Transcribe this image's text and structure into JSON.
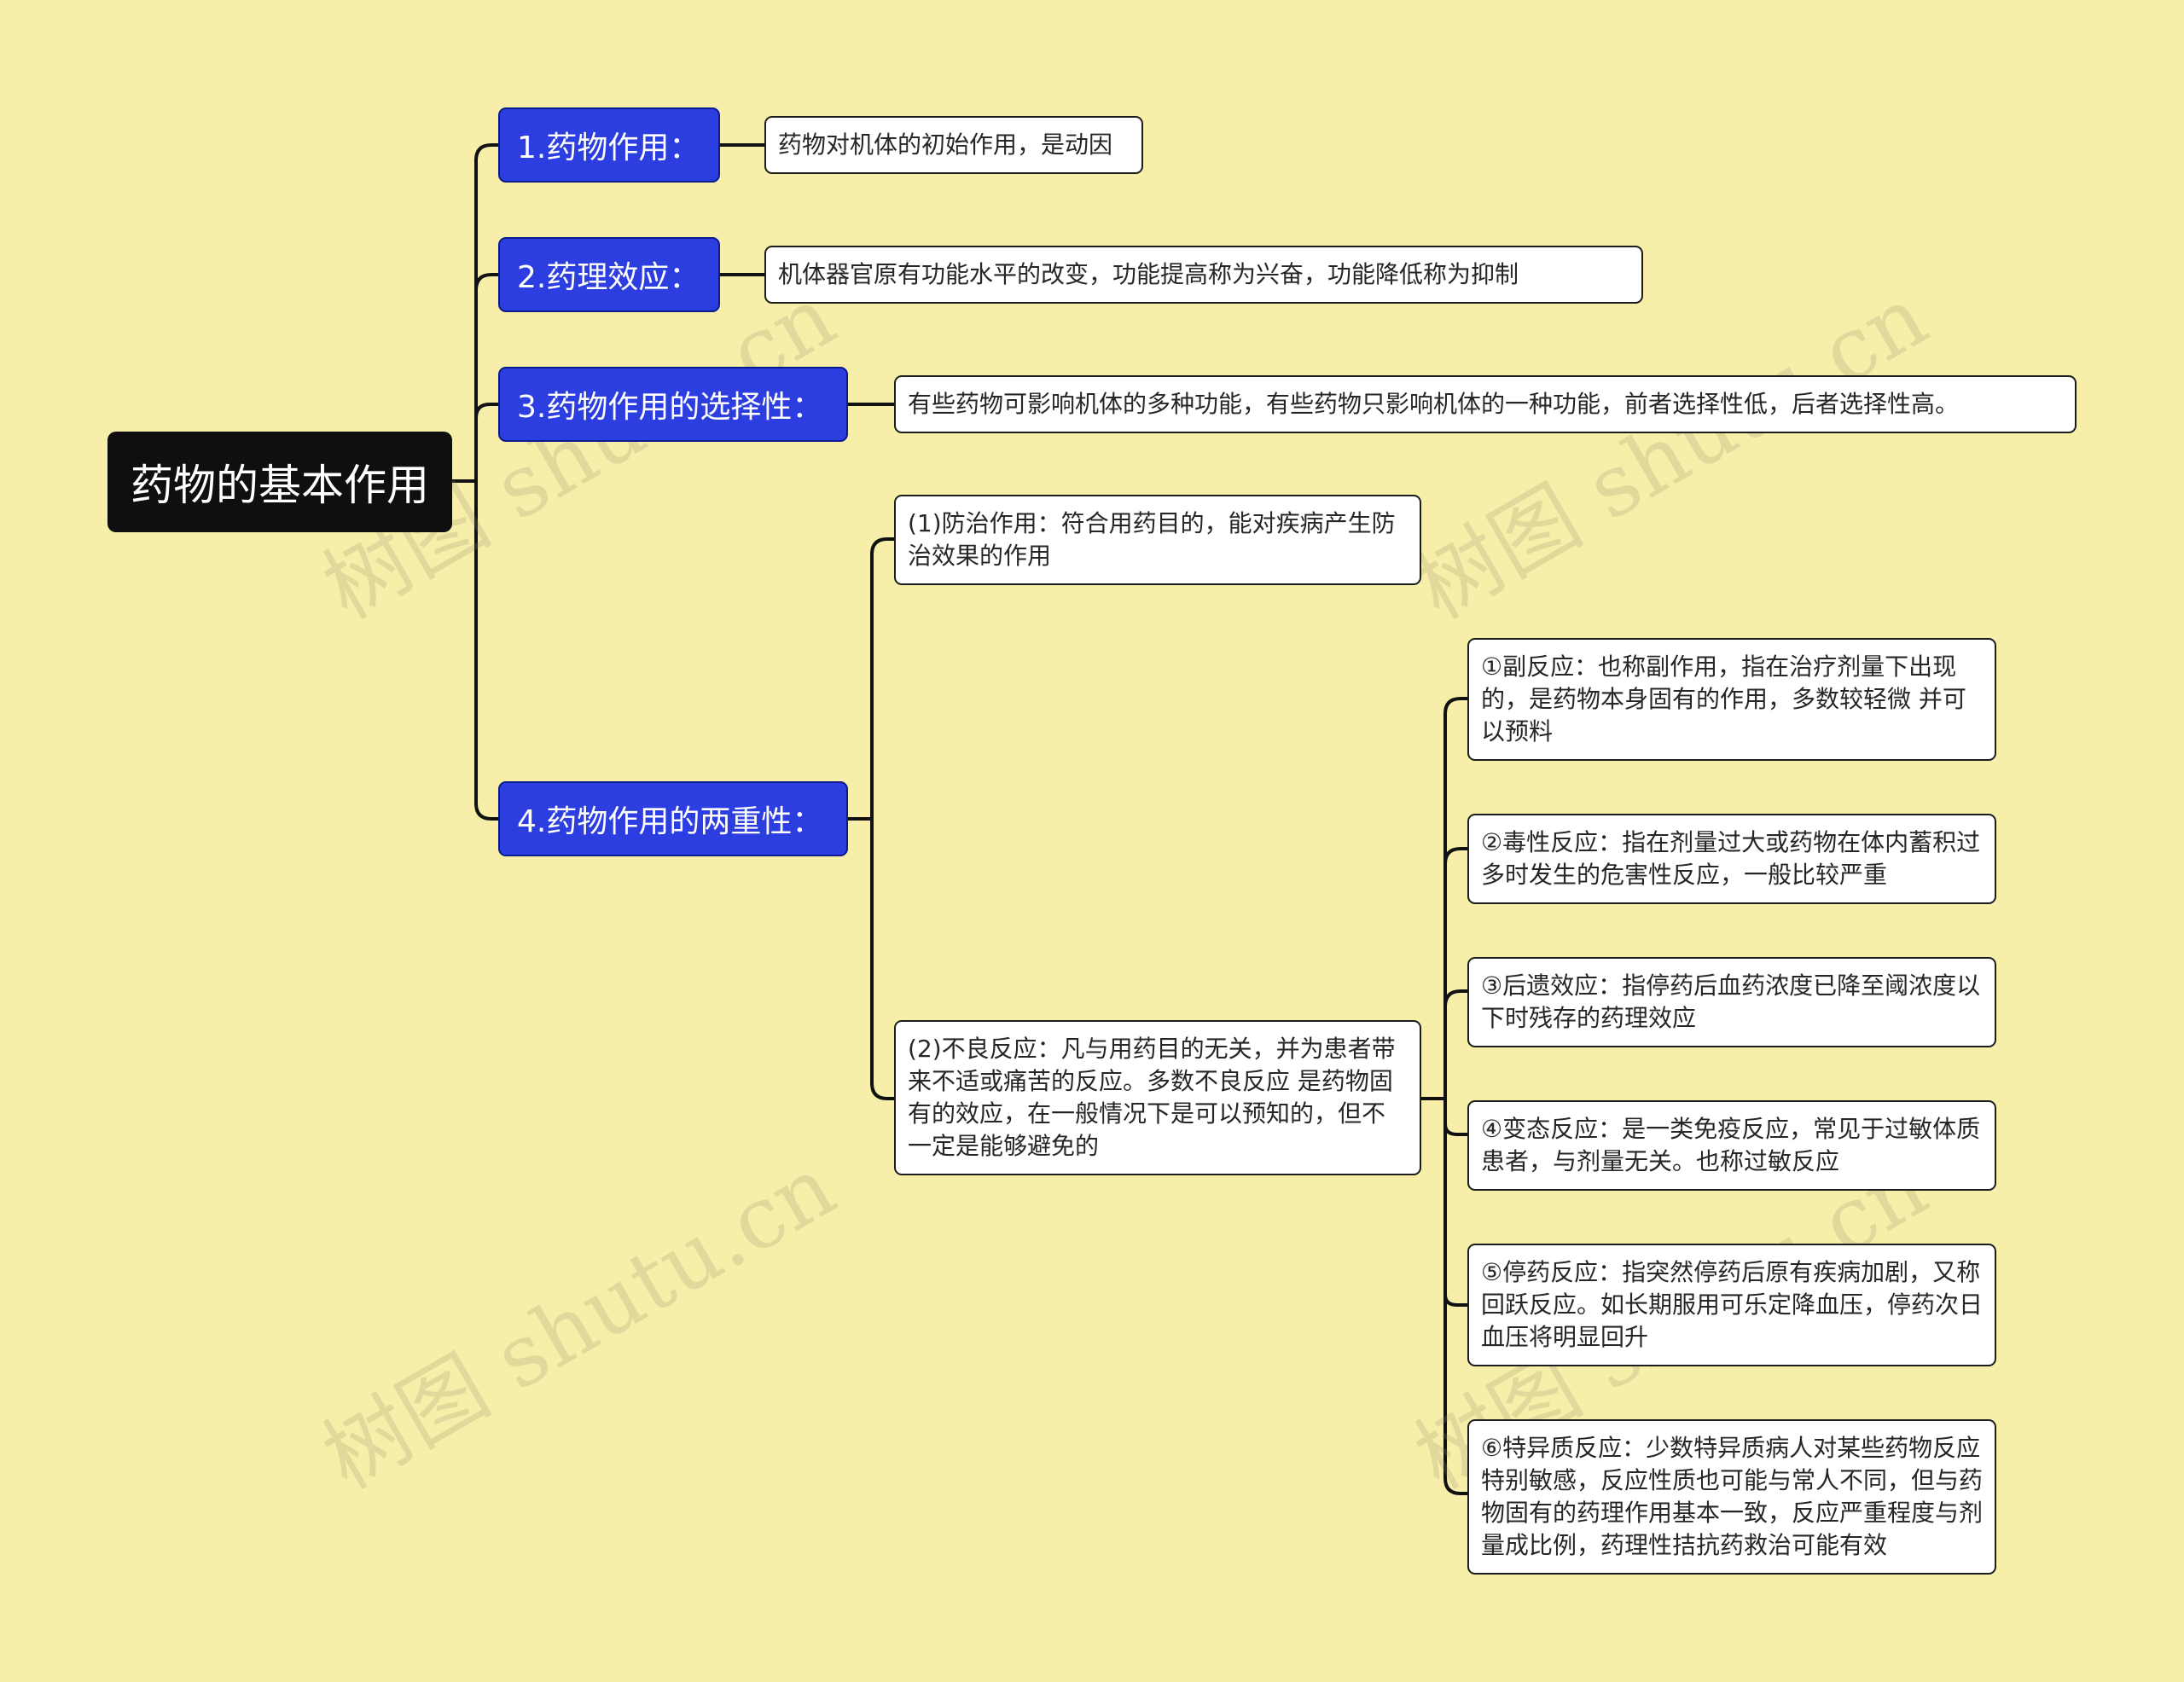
{
  "root": {
    "label": "药物的基本作用"
  },
  "branches": [
    {
      "label": "1.药物作用：",
      "detail": "药物对机体的初始作用，是动因"
    },
    {
      "label": "2.药理效应：",
      "detail": "机体器官原有功能水平的改变，功能提高称为兴奋，功能降低称为抑制"
    },
    {
      "label": "3.药物作用的选择性：",
      "detail": "有些药物可影响机体的多种功能，有些药物只影响机体的一种功能，前者选择性低，后者选择性高。"
    },
    {
      "label": "4.药物作用的两重性："
    }
  ],
  "duality": {
    "prevention": "(1)防治作用：符合用药目的，能对疾病产生防治效果的作用",
    "adverse": "(2)不良反应：凡与用药目的无关，并为患者带来不适或痛苦的反应。多数不良反应 是药物固有的效应，在一般情况下是可以预知的，但不一定是能够避免的",
    "adverse_types": [
      "①副反应：也称副作用，指在治疗剂量下出现的，是药物本身固有的作用，多数较轻微 并可以预料",
      "②毒性反应：指在剂量过大或药物在体内蓄积过多时发生的危害性反应，一般比较严重",
      "③后遗效应：指停药后血药浓度已降至阈浓度以下时残存的药理效应",
      "④变态反应：是一类免疫反应，常见于过敏体质患者，与剂量无关。也称过敏反应",
      "⑤停药反应：指突然停药后原有疾病加剧，又称回跃反应。如长期服用可乐定降血压，停药次日血压将明显回升",
      "⑥特异质反应：少数特异质病人对某些药物反应特别敏感，反应性质也可能与常人不同，但与药物固有的药理作用基本一致，反应严重程度与剂量成比例，药理性拮抗药救治可能有效"
    ]
  },
  "watermark": "树图 shutu.cn",
  "colors": {
    "background": "#f6eea9",
    "root": "#0f0f0f",
    "branch": "#2d3ee0",
    "leaf": "#ffffff",
    "line": "#111111"
  }
}
